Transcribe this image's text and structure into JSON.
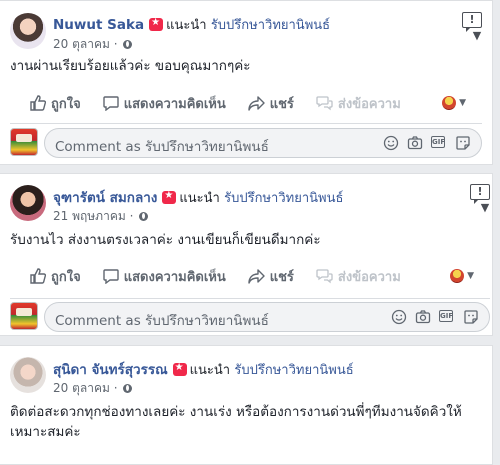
{
  "posts": [
    {
      "author": "Nuwut Saka",
      "recommend_text": "แนะนำ",
      "target": "รับปรึกษาวิทยานิพนธ์",
      "date": "20 ตุลาคม",
      "dot": "·",
      "text": "งานผ่านเรียบร้อยแล้วค่ะ ขอบคุณมากๆค่ะ"
    },
    {
      "author": "จุฑารัตน์ สมกลาง",
      "recommend_text": "แนะนำ",
      "target": "รับปรึกษาวิทยานิพนธ์",
      "date": "21 พฤษภาคม",
      "dot": "·",
      "text": "รับงานไว ส่งงานตรงเวลาค่ะ งานเขียนก็เขียนดีมากค่ะ"
    },
    {
      "author": "สุนิดา จันทร์สุวรรณ",
      "recommend_text": "แนะนำ",
      "target": "รับปรึกษาวิทยานิพนธ์",
      "date": "20 ตุลาคม",
      "dot": "·",
      "text": "ติดต่อสะดวกทุกช่องทางเลยค่ะ งานเร่ง หรือต้องการงานด่วนพี่ๆทีมงานจัดคิวให้เหมาะสมค่ะ"
    }
  ],
  "actions": {
    "like": "ถูกใจ",
    "comment": "แสดงความคิดเห็น",
    "share": "แชร์",
    "send": "ส่งข้อความ"
  },
  "report_icon": "!",
  "more_icon": "▼",
  "comment_placeholder": "Comment as รับปรึกษาวิทยานิพนธ์",
  "comment_tools": [
    "emoji-icon",
    "camera-icon",
    "gif-icon",
    "sticker-icon"
  ],
  "gif_label": "GIF",
  "colors": {
    "link": "#385898",
    "recommend_badge": "#f0284a",
    "background": "#e9ebee"
  }
}
